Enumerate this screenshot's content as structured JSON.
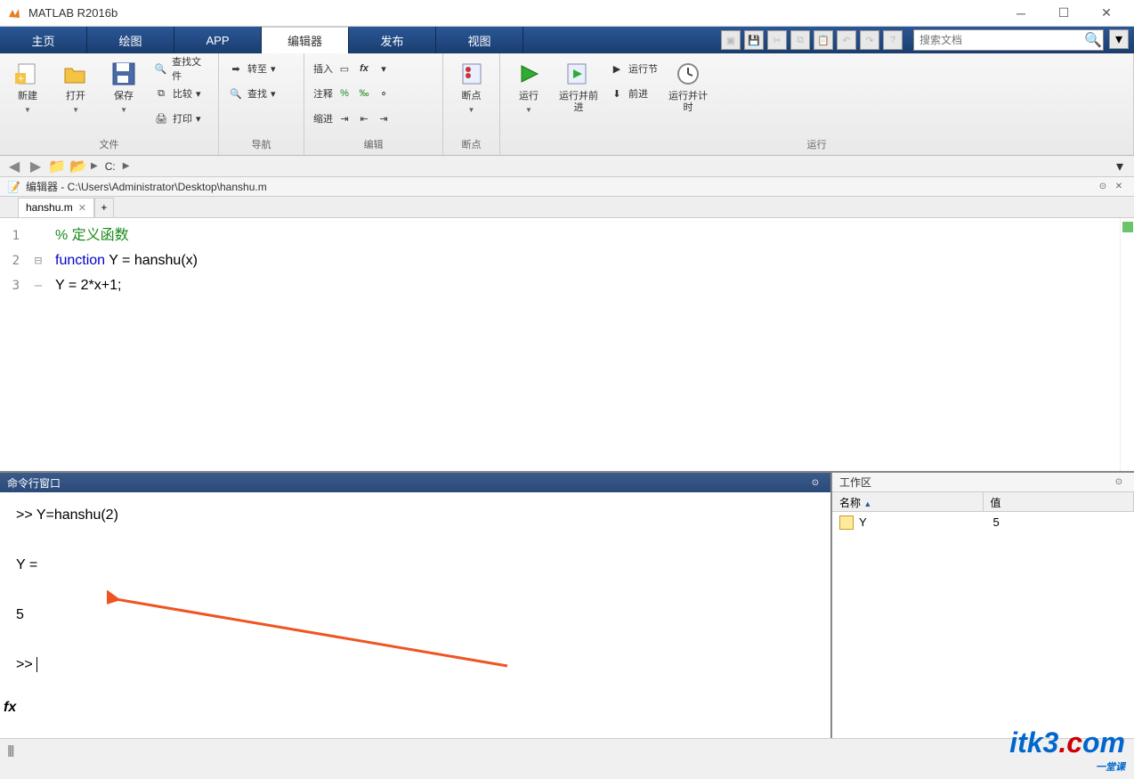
{
  "window": {
    "title": "MATLAB R2016b"
  },
  "tabs": {
    "home": "主页",
    "plots": "绘图",
    "apps": "APP",
    "editor": "编辑器",
    "publish": "发布",
    "view": "视图"
  },
  "search": {
    "placeholder": "搜索文档"
  },
  "ribbon": {
    "file_group": "文件",
    "new": "新建",
    "open": "打开",
    "save": "保存",
    "findfiles": "查找文件",
    "compare": "比较",
    "print": "打印",
    "nav_group": "导航",
    "goto": "转至",
    "find": "查找",
    "edit_group": "编辑",
    "insert": "插入",
    "comment": "注释",
    "indent": "缩进",
    "bp_group": "断点",
    "breakpoints": "断点",
    "run_group": "运行",
    "run": "运行",
    "runadvance": "运行并前进",
    "runsection": "运行节",
    "advance": "前进",
    "runtime": "运行并计时"
  },
  "path": {
    "drive": "C:"
  },
  "editor_header": "编辑器 - C:\\Users\\Administrator\\Desktop\\hanshu.m",
  "file_tab": "hanshu.m",
  "code": {
    "l1": "% 定义函数",
    "l2a": "function",
    "l2b": " Y = hanshu(x)",
    "l3": "Y = 2*x+1;"
  },
  "cmd": {
    "title": "命令行窗口",
    "line1": ">> Y=hanshu(2)",
    "line2": "Y =",
    "line3": "     5",
    "prompt": ">> "
  },
  "workspace": {
    "title": "工作区",
    "col_name": "名称",
    "col_value": "值",
    "vars": [
      {
        "name": "Y",
        "value": "5"
      }
    ]
  },
  "watermark": {
    "a": "itk3",
    "b": ".c",
    "c": "om",
    "sub": "一堂课"
  }
}
